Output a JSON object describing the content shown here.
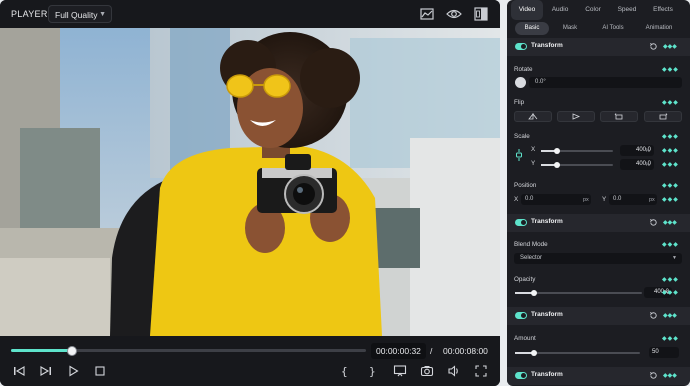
{
  "player": {
    "title": "PLAYER",
    "quality": "Full Quality",
    "progress": 0.17,
    "current_time": "00:00:00:32",
    "separator": "/",
    "total_time": "00:00:08:00",
    "image_alt": "Woman in yellow sweater holding a camera"
  },
  "panel": {
    "tabs": [
      "Video",
      "Audio",
      "Color",
      "Speed",
      "Effects"
    ],
    "subtabs": [
      "Basic",
      "Mask",
      "AI Tools",
      "Animation"
    ],
    "transform1": {
      "title": "Transform"
    },
    "rotate": {
      "label": "Rotate",
      "value": "0.0°"
    },
    "flip": {
      "label": "Flip"
    },
    "scale": {
      "label": "Scale",
      "x_label": "X",
      "y_label": "Y",
      "x_value": "400.0",
      "y_value": "400.0",
      "unit": "%"
    },
    "position": {
      "label": "Position",
      "x_label": "X",
      "x_value": "0.0",
      "y_label": "Y",
      "y_value": "0.0",
      "unit": "px"
    },
    "transform2": {
      "title": "Transform"
    },
    "blend": {
      "label": "Blend Mode",
      "value": "Selector"
    },
    "opacity": {
      "label": "Opacity",
      "value": "400.0",
      "unit": "%"
    },
    "transform3": {
      "title": "Transform"
    },
    "amount": {
      "label": "Amount",
      "value": "50"
    },
    "transform4": {
      "title": "Transform"
    }
  },
  "colors": {
    "accent": "#5ee3cb",
    "bg": "#1c1d22",
    "player_bg": "#141519"
  }
}
